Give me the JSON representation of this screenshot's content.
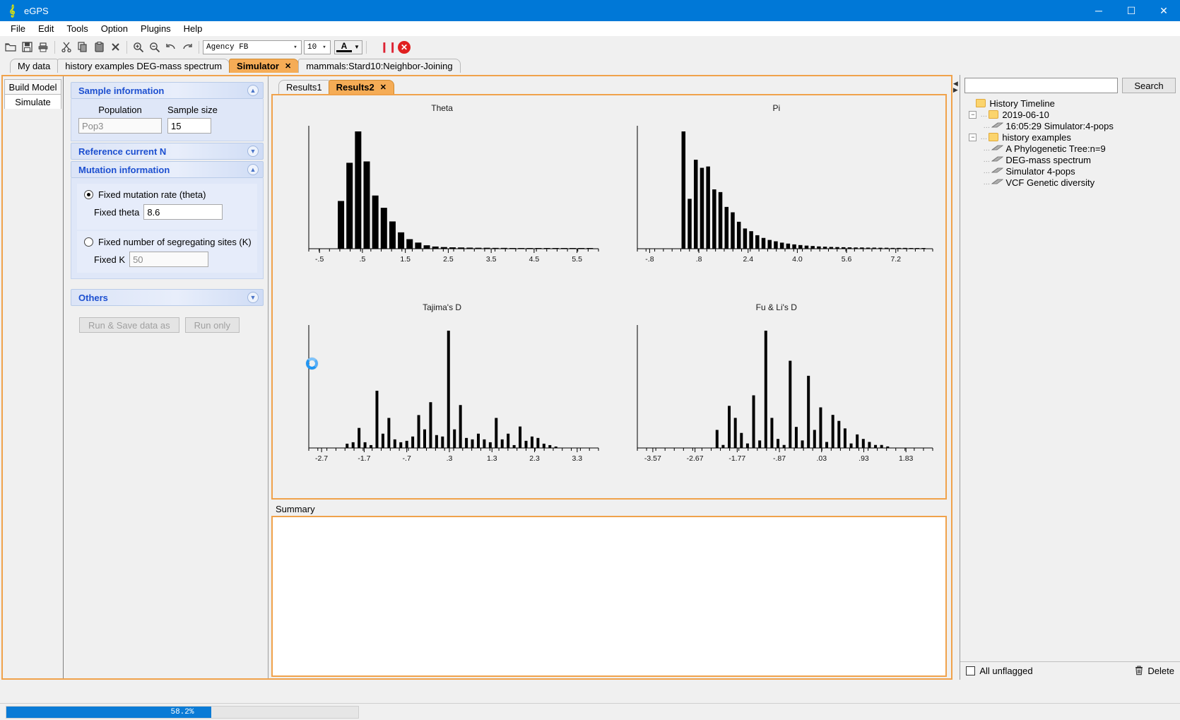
{
  "window": {
    "title": "eGPS",
    "logo_icon": "treble-clef-logo-icon",
    "minimize": "─",
    "maximize": "☐",
    "close": "✕"
  },
  "menubar": [
    {
      "label": "File"
    },
    {
      "label": "Edit"
    },
    {
      "label": "Tools"
    },
    {
      "label": "Option"
    },
    {
      "label": "Plugins"
    },
    {
      "label": "Help"
    }
  ],
  "toolbar": {
    "icons": [
      "open-folder-icon",
      "save-icon",
      "print-icon",
      "cut-icon",
      "copy-icon",
      "paste-icon",
      "delete-icon",
      "zoom-in-icon",
      "zoom-out-icon",
      "undo-icon",
      "redo-icon"
    ],
    "font_family": "Agency FB",
    "font_size": "10",
    "font_color_glyph": "A",
    "pause_label": "▐▐",
    "stop_label": "✕"
  },
  "main_tabs": [
    {
      "label": "My data",
      "active": false,
      "closable": false
    },
    {
      "label": "history examples DEG-mass spectrum",
      "active": false,
      "closable": false
    },
    {
      "label": "Simulator",
      "active": true,
      "closable": true,
      "close_label": "✕"
    },
    {
      "label": "mammals:Stard10:Neighbor-Joining",
      "active": false,
      "closable": false
    }
  ],
  "sidebar_tabs": [
    {
      "label": "Build Model",
      "active": false
    },
    {
      "label": "Simulate",
      "active": true
    }
  ],
  "properties": {
    "sample_information": {
      "title": "Sample information",
      "collapse_icon": "chevron-up-icon",
      "population_header": "Population",
      "sample_size_header": "Sample size",
      "population_value": "Pop3",
      "sample_size_value": "15"
    },
    "reference_current_n": {
      "title": "Reference current N",
      "collapse_icon": "chevron-down-icon"
    },
    "mutation_information": {
      "title": "Mutation information",
      "collapse_icon": "chevron-up-icon",
      "option_theta": "Fixed mutation rate (theta)",
      "option_theta_selected": true,
      "fixed_theta_label": "Fixed theta",
      "fixed_theta_value": "8.6",
      "option_k": "Fixed number of segregating sites (K)",
      "option_k_selected": false,
      "fixed_k_label": "Fixed K",
      "fixed_k_value": "50"
    },
    "others": {
      "title": "Others",
      "collapse_icon": "chevron-down-icon"
    },
    "run_save_button": "Run & Save data as",
    "run_only_button": "Run only"
  },
  "result_tabs": [
    {
      "label": "Results1",
      "active": false,
      "closable": false
    },
    {
      "label": "Results2",
      "active": true,
      "closable": true,
      "close_label": "✕"
    }
  ],
  "summary": {
    "label": "Summary",
    "content": ""
  },
  "history": {
    "search_value": "",
    "search_button": "Search",
    "root_label": "History Timeline",
    "root_icon": "folder-icon",
    "groups": [
      {
        "label": "2019-06-10",
        "icon": "folder-icon",
        "expander": "−",
        "items": [
          {
            "label": "16:05:29 Simulator:4-pops",
            "icon": "document-leaf-icon"
          }
        ]
      },
      {
        "label": "history examples",
        "icon": "folder-icon",
        "expander": "−",
        "items": [
          {
            "label": "A Phylogenetic Tree:n=9",
            "icon": "document-leaf-icon"
          },
          {
            "label": "DEG-mass spectrum",
            "icon": "document-leaf-icon"
          },
          {
            "label": "Simulator 4-pops",
            "icon": "document-leaf-icon"
          },
          {
            "label": "VCF Genetic diversity",
            "icon": "document-leaf-icon"
          }
        ]
      }
    ],
    "all_unflagged_label": "All unflagged",
    "delete_label": "Delete",
    "delete_icon": "trash-icon"
  },
  "statusbar": {
    "progress_percent": 58.2,
    "progress_text": "58.2%"
  },
  "colors": {
    "title_bar": "#0078d7",
    "active_tab": "#f5ac56",
    "panel_border": "#f0a24b",
    "section_text": "#1c4fd0",
    "progress_fill": "#0a7bd6",
    "spinner": "#2196f3",
    "plot_bg": "#f0f0f0",
    "bar": "#000000"
  },
  "chart_data": [
    {
      "type": "bar",
      "title": "Theta",
      "xlabel": "",
      "ylabel": "",
      "grid": false,
      "legend": "none",
      "tick_labels": [
        "-.5",
        ".5",
        "1.5",
        "2.5",
        "3.5",
        "4.5",
        "5.5"
      ],
      "tick_positions": [
        -0.5,
        0.5,
        1.5,
        2.5,
        3.5,
        4.5,
        5.5
      ],
      "xlim": [
        -0.75,
        6.0
      ],
      "ylim": [
        0,
        100
      ],
      "x": [
        0.0,
        0.2,
        0.4,
        0.6,
        0.8,
        1.0,
        1.2,
        1.4,
        1.6,
        1.8,
        2.0,
        2.2,
        2.4,
        2.6,
        2.8,
        3.0,
        3.2,
        3.4,
        3.6,
        3.8,
        4.0,
        4.2,
        4.4,
        4.6,
        4.8,
        5.0,
        5.2,
        5.4,
        5.6,
        5.8
      ],
      "values": [
        35,
        63,
        86,
        64,
        39,
        30,
        20,
        12,
        7,
        4.5,
        2.5,
        1.6,
        1.2,
        1.0,
        0.9,
        0.8,
        0.7,
        0.7,
        0.6,
        0.6,
        0.5,
        0.5,
        0.5,
        0.4,
        0.4,
        0.4,
        0.3,
        0.3,
        0.3,
        0.3
      ]
    },
    {
      "type": "bar",
      "title": "Pi",
      "xlabel": "",
      "ylabel": "",
      "grid": false,
      "legend": "none",
      "tick_labels": [
        "-.8",
        ".8",
        "2.4",
        "4.0",
        "5.6",
        "7.2"
      ],
      "tick_positions": [
        -0.8,
        0.8,
        2.4,
        4.0,
        5.6,
        7.2
      ],
      "xlim": [
        -1.2,
        8.4
      ],
      "ylim": [
        0,
        100
      ],
      "x": [
        0.3,
        0.5,
        0.7,
        0.9,
        1.1,
        1.3,
        1.5,
        1.7,
        1.9,
        2.1,
        2.3,
        2.5,
        2.7,
        2.9,
        3.1,
        3.3,
        3.5,
        3.7,
        3.9,
        4.1,
        4.3,
        4.5,
        4.7,
        4.9,
        5.1,
        5.3,
        5.5,
        5.7,
        5.9,
        6.1,
        6.3,
        6.5,
        6.7,
        6.9,
        7.1,
        7.3,
        7.5,
        7.7,
        7.9,
        8.1
      ],
      "values": [
        87,
        37,
        66,
        60,
        61,
        44,
        42,
        31,
        27,
        20,
        15,
        13,
        10,
        8,
        6.5,
        5.5,
        4.5,
        3.8,
        3.2,
        2.7,
        2.3,
        2.0,
        1.7,
        1.5,
        1.3,
        1.2,
        1.1,
        1.0,
        0.9,
        0.9,
        0.8,
        0.8,
        0.7,
        0.7,
        0.6,
        0.6,
        0.6,
        0.5,
        0.5,
        0.5
      ]
    },
    {
      "type": "bar",
      "title": "Tajima's D",
      "xlabel": "",
      "ylabel": "",
      "grid": false,
      "legend": "none",
      "tick_labels": [
        "-2.7",
        "-1.7",
        "-.7",
        ".3",
        "1.3",
        "2.3",
        "3.3"
      ],
      "tick_positions": [
        -2.7,
        -1.7,
        -0.7,
        0.3,
        1.3,
        2.3,
        3.3
      ],
      "xlim": [
        -3.0,
        3.8
      ],
      "ylim": [
        0,
        100
      ],
      "x": [
        -2.1,
        -1.96,
        -1.82,
        -1.68,
        -1.54,
        -1.4,
        -1.26,
        -1.12,
        -0.98,
        -0.84,
        -0.7,
        -0.56,
        -0.42,
        -0.28,
        -0.14,
        0.0,
        0.14,
        0.28,
        0.42,
        0.56,
        0.7,
        0.84,
        0.98,
        1.12,
        1.26,
        1.4,
        1.54,
        1.68,
        1.82,
        1.96,
        2.1,
        2.24,
        2.38,
        2.52,
        2.66,
        2.8
      ],
      "values": [
        3,
        4,
        14,
        4,
        2,
        40,
        10,
        21,
        6,
        4,
        5,
        8,
        23,
        13,
        32,
        9,
        8,
        82,
        13,
        30,
        7,
        6,
        10,
        6,
        4,
        21,
        6,
        10,
        2,
        15,
        5,
        8,
        7,
        3,
        2,
        1
      ]
    },
    {
      "type": "bar",
      "title": "Fu & Li's D",
      "xlabel": "",
      "ylabel": "",
      "grid": false,
      "legend": "none",
      "tick_labels": [
        "-3.57",
        "-2.67",
        "-1.77",
        "-.87",
        ".03",
        ".93",
        "1.83"
      ],
      "tick_positions": [
        -3.57,
        -2.67,
        -1.77,
        -0.87,
        0.03,
        0.93,
        1.83
      ],
      "xlim": [
        -3.9,
        2.4
      ],
      "ylim": [
        0,
        100
      ],
      "x": [
        -2.2,
        -2.07,
        -1.94,
        -1.81,
        -1.68,
        -1.55,
        -1.42,
        -1.29,
        -1.16,
        -1.03,
        -0.9,
        -0.77,
        -0.64,
        -0.51,
        -0.38,
        -0.25,
        -0.12,
        0.01,
        0.14,
        0.27,
        0.4,
        0.53,
        0.66,
        0.79,
        0.92,
        1.05,
        1.18,
        1.31,
        1.44
      ],
      "values": [
        12,
        2,
        28,
        20,
        10,
        3,
        35,
        5,
        78,
        20,
        6,
        2,
        58,
        14,
        5,
        48,
        12,
        27,
        4,
        22,
        18,
        13,
        3,
        9,
        6,
        4,
        2,
        2,
        1
      ]
    }
  ]
}
